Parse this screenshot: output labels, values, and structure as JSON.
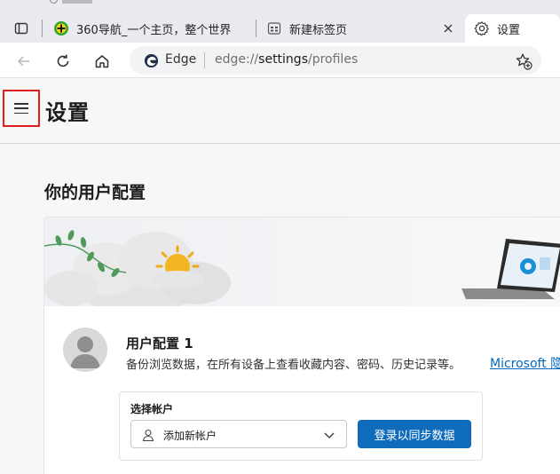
{
  "tabs": [
    {
      "title": "360导航_一个主页，整个世界",
      "icon": "360-favicon-icon"
    },
    {
      "title": "新建标签页",
      "icon": "newtab-page-icon"
    },
    {
      "title": "设置",
      "icon": "gear-icon"
    }
  ],
  "address_bar": {
    "browser_label": "Edge",
    "url_prefix": "edge://",
    "url_host": "settings",
    "url_path": "/profiles"
  },
  "settings": {
    "page_title": "设置",
    "section_title": "你的用户配置",
    "profile": {
      "name": "用户配置 1",
      "description": "备份浏览数据，在所有设备上查看收藏内容、密码、历史记录等。",
      "link": "Microsoft 隐"
    },
    "account": {
      "label": "选择帐户",
      "selected": "添加新帐户",
      "sync_button": "登录以同步数据"
    }
  },
  "colors": {
    "accent": "#0f6cbd",
    "link": "#0067c0",
    "highlight_border": "#e02020"
  }
}
